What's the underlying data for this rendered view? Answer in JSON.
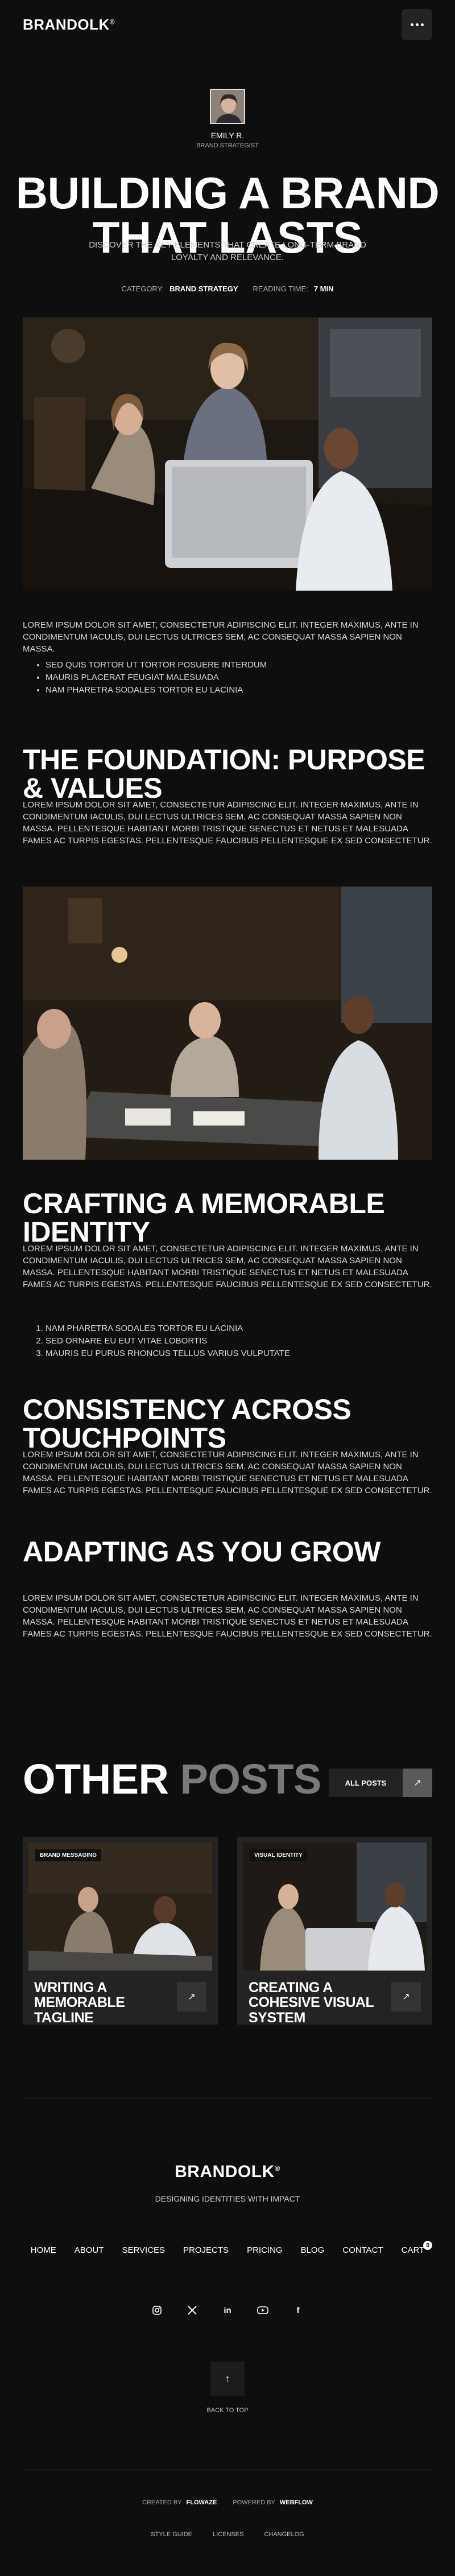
{
  "header": {
    "logo": "BRANDOLK",
    "logo_mark": "®",
    "menu_icon": "ellipsis-icon"
  },
  "author": {
    "name": "EMILY R.",
    "role": "BRAND STRATEGIST"
  },
  "article": {
    "title": "BUILDING A BRAND THAT LASTS",
    "subtitle": "DISCOVER THE KEY ELEMENTS THAT CREATE LONG-TERM BRAND LOYALTY AND RELEVANCE.",
    "category_label": "CATEGORY:",
    "category": "BRAND STRATEGY",
    "reading_label": "READING TIME:",
    "reading_time": "7 MIN",
    "para1": "LOREM IPSUM DOLOR SIT AMET, CONSECTETUR ADIPISCING ELIT. INTEGER MAXIMUS, ANTE IN CONDIMENTUM IACULIS, DUI LECTUS ULTRICES SEM, AC CONSEQUAT MASSA SAPIEN NON MASSA.",
    "bullets": [
      "SED QUIS TORTOR UT TORTOR POSUERE INTERDUM",
      "MAURIS PLACERAT FEUGIAT MALESUADA",
      "NAM PHARETRA SODALES TORTOR EU LACINIA"
    ],
    "h_foundation": "THE FOUNDATION: PURPOSE & VALUES",
    "para2": "LOREM IPSUM DOLOR SIT AMET, CONSECTETUR ADIPISCING ELIT. INTEGER MAXIMUS, ANTE IN CONDIMENTUM IACULIS, DUI LECTUS ULTRICES SEM, AC CONSEQUAT MASSA SAPIEN NON MASSA. PELLENTESQUE HABITANT MORBI TRISTIQUE SENECTUS ET NETUS ET MALESUADA FAMES AC TURPIS EGESTAS. PELLENTESQUE FAUCIBUS PELLENTESQUE EX SED CONSECTETUR.",
    "h_identity": "CRAFTING A MEMORABLE IDENTITY",
    "para3": "LOREM IPSUM DOLOR SIT AMET, CONSECTETUR ADIPISCING ELIT. INTEGER MAXIMUS, ANTE IN CONDIMENTUM IACULIS, DUI LECTUS ULTRICES SEM, AC CONSEQUAT MASSA SAPIEN NON MASSA. PELLENTESQUE HABITANT MORBI TRISTIQUE SENECTUS ET NETUS ET MALESUADA FAMES AC TURPIS EGESTAS. PELLENTESQUE FAUCIBUS PELLENTESQUE EX SED CONSECTETUR.",
    "numbered": [
      "NAM PHARETRA SODALES TORTOR EU LACINIA",
      "SED ORNARE EU EUT VITAE LOBORTIS",
      "MAURIS EU PURUS RHONCUS TELLUS VARIUS VULPUTATE"
    ],
    "h_consistency": "CONSISTENCY ACROSS TOUCHPOINTS",
    "para4": "LOREM IPSUM DOLOR SIT AMET, CONSECTETUR ADIPISCING ELIT. INTEGER MAXIMUS, ANTE IN CONDIMENTUM IACULIS, DUI LECTUS ULTRICES SEM, AC CONSEQUAT MASSA SAPIEN NON MASSA. PELLENTESQUE HABITANT MORBI TRISTIQUE SENECTUS ET NETUS ET MALESUADA FAMES AC TURPIS EGESTAS. PELLENTESQUE FAUCIBUS PELLENTESQUE EX SED CONSECTETUR.",
    "h_adapting": "ADAPTING AS YOU GROW",
    "para5": "LOREM IPSUM DOLOR SIT AMET, CONSECTETUR ADIPISCING ELIT. INTEGER MAXIMUS, ANTE IN CONDIMENTUM IACULIS, DUI LECTUS ULTRICES SEM, AC CONSEQUAT MASSA SAPIEN NON MASSA. PELLENTESQUE HABITANT MORBI TRISTIQUE SENECTUS ET NETUS ET MALESUADA FAMES AC TURPIS EGESTAS. PELLENTESQUE FAUCIBUS PELLENTESQUE EX SED CONSECTETUR."
  },
  "other_posts": {
    "title_a": "OTHER",
    "title_b": "POSTS",
    "all_label": "ALL POSTS",
    "cards": [
      {
        "tag": "BRAND MESSAGING",
        "title": "WRITING A MEMORABLE TAGLINE"
      },
      {
        "tag": "VISUAL IDENTITY",
        "title": "CREATING A COHESIVE VISUAL SYSTEM"
      }
    ]
  },
  "footer": {
    "logo": "BRANDOLK",
    "logo_mark": "®",
    "tagline": "DESIGNING IDENTITIES WITH IMPACT",
    "nav": [
      "HOME",
      "ABOUT",
      "SERVICES",
      "PROJECTS",
      "PRICING",
      "BLOG",
      "CONTACT"
    ],
    "cart_label": "CART",
    "cart_count": "0",
    "social": [
      "instagram-icon",
      "x-icon",
      "linkedin-icon",
      "youtube-icon",
      "facebook-icon"
    ],
    "back_to_top": "BACK TO TOP",
    "created_label": "CREATED BY",
    "created_by": "FLOWAZE",
    "powered_label": "POWERED BY",
    "powered_by": "WEBFLOW",
    "links": [
      "STYLE GUIDE",
      "LICENSES",
      "CHANGELOG"
    ]
  }
}
